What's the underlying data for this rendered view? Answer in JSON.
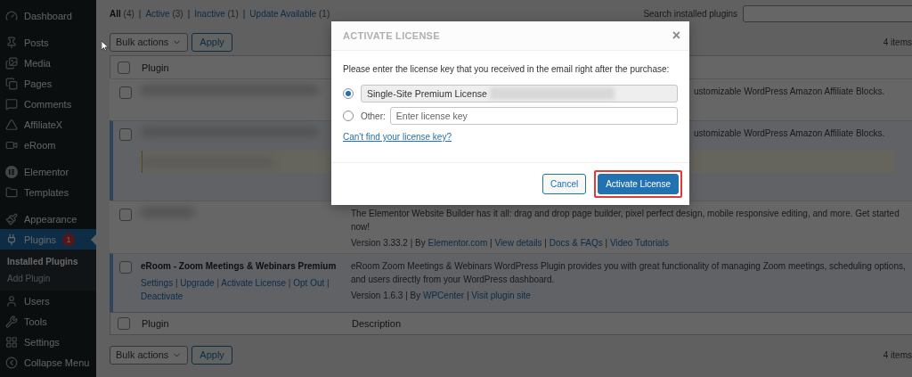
{
  "sidebar": {
    "groups": [
      [
        {
          "label": "Dashboard",
          "selected": false
        }
      ],
      [
        {
          "label": "Posts",
          "selected": false
        },
        {
          "label": "Media",
          "selected": false
        },
        {
          "label": "Pages",
          "selected": false
        },
        {
          "label": "Comments",
          "selected": false
        },
        {
          "label": "AffiliateX",
          "selected": false
        },
        {
          "label": "eRoom",
          "selected": false
        }
      ],
      [
        {
          "label": "Elementor",
          "selected": false
        },
        {
          "label": "Templates",
          "selected": false
        }
      ],
      [
        {
          "label": "Appearance",
          "selected": false
        },
        {
          "label": "Plugins",
          "selected": true,
          "badge": "1",
          "children": [
            {
              "label": "Installed Plugins",
              "selected": true
            },
            {
              "label": "Add Plugin",
              "selected": false
            }
          ]
        },
        {
          "label": "Users",
          "selected": false
        },
        {
          "label": "Tools",
          "selected": false
        },
        {
          "label": "Settings",
          "selected": false
        }
      ]
    ],
    "collapse": {
      "label": "Collapse Menu"
    }
  },
  "filters": [
    {
      "label": "All",
      "count": "(4)",
      "selected": true,
      "separator": "|"
    },
    {
      "label": "Active",
      "count": "(3)",
      "selected": false,
      "separator": "|"
    },
    {
      "label": "Inactive",
      "count": "(1)",
      "selected": false,
      "separator": "|"
    },
    {
      "label": "Update Available",
      "count": "(1)",
      "selected": false
    }
  ],
  "search": {
    "label": "Search installed plugins"
  },
  "bulk_top": {
    "select": "Bulk actions",
    "button": "Apply",
    "count": "4 items"
  },
  "table": {
    "header": {
      "label": "Plugin",
      "checked": false
    },
    "rows": [
      {
        "kind": "blurred",
        "active": false,
        "checked": false,
        "notice": false,
        "description": "ustomizable WordPress Amazon Affiliate Blocks."
      },
      {
        "kind": "blurred",
        "active": true,
        "checked": false,
        "notice": true,
        "description": "ustomizable WordPress Amazon Affiliate Blocks."
      },
      {
        "kind": "blurred",
        "active": false,
        "checked": false,
        "notice": false,
        "description": "The Elementor Website Builder has it all: drag and drop page builder, pixel perfect design, mobile responsive editing, and more. Get started now!",
        "meta": [
          {
            "kind": "text",
            "text": "Version 3.33.2 | By "
          },
          {
            "kind": "link",
            "text": "Elementor.com"
          },
          {
            "kind": "text",
            "text": " | "
          },
          {
            "kind": "link",
            "text": "View details"
          },
          {
            "kind": "text",
            "text": " | "
          },
          {
            "kind": "link",
            "text": "Docs & FAQs"
          },
          {
            "kind": "text",
            "text": " | "
          },
          {
            "kind": "link",
            "text": "Video Tutorials"
          }
        ]
      },
      {
        "kind": "plain",
        "active": true,
        "checked": false,
        "notice": false,
        "name": "eRoom - Zoom Meetings & Webinars Premium",
        "actions": [
          {
            "kind": "link",
            "text": "Settings"
          },
          {
            "kind": "text",
            "text": " | "
          },
          {
            "kind": "link",
            "text": "Upgrade"
          },
          {
            "kind": "text",
            "text": " | "
          },
          {
            "kind": "link",
            "text": "Activate License"
          },
          {
            "kind": "text",
            "text": " | "
          },
          {
            "kind": "link",
            "text": "Opt Out"
          },
          {
            "kind": "text",
            "text": " | "
          },
          {
            "kind": "link",
            "text": "Deactivate"
          }
        ],
        "description": "eRoom Zoom Meetings & Webinars WordPress Plugin provides you with great functionality of managing Zoom meetings, scheduling options, and users directly from your WordPress dashboard.",
        "meta": [
          {
            "kind": "text",
            "text": "Version 1.6.3 | By "
          },
          {
            "kind": "link",
            "text": "WPCenter"
          },
          {
            "kind": "text",
            "text": " | "
          },
          {
            "kind": "link",
            "text": "Visit plugin site"
          }
        ]
      }
    ],
    "footer": {
      "label": "Plugin",
      "checked": false,
      "description": "Description"
    }
  },
  "bulk_bottom": {
    "select": "Bulk actions",
    "button": "Apply",
    "count": "4 items"
  },
  "modal": {
    "title": "ACTIVATE LICENSE",
    "close": "×",
    "prompt": "Please enter the license key that you received in the email right after the purchase:",
    "options": [
      {
        "kind": "license",
        "value": "Single-Site Premium License",
        "selected": true
      },
      {
        "kind": "other",
        "label": "Other:",
        "placeholder": "Enter license key",
        "selected": false
      }
    ],
    "help_link": "Can't find your license key?",
    "buttons": [
      {
        "label": "Cancel",
        "kind": "secondary",
        "highlighted": false
      },
      {
        "label": "Activate License",
        "kind": "primary",
        "highlighted": true
      }
    ]
  }
}
